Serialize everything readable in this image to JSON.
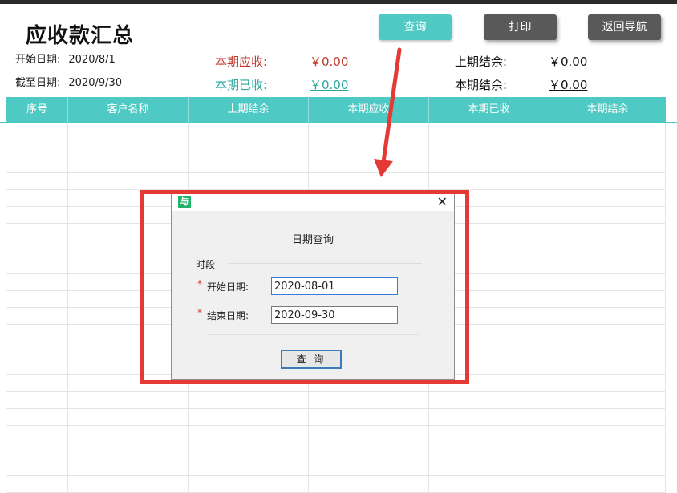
{
  "title": "应收款汇总",
  "meta": {
    "start_label": "开始日期:",
    "start_value": "2020/8/1",
    "end_label": "截至日期:",
    "end_value": "2020/9/30"
  },
  "buttons": {
    "query": "查询",
    "print": "打印",
    "nav": "返回导航"
  },
  "summary": {
    "receivable_label": "本期应收:",
    "receivable_value": "￥0.00",
    "received_label": "本期已收:",
    "received_value": "￥0.00",
    "prev_balance_label": "上期结余:",
    "prev_balance_value": "￥0.00",
    "curr_balance_label": "本期结余:",
    "curr_balance_value": "￥0.00"
  },
  "table": {
    "columns": [
      "序号",
      "客户名称",
      "上期结余",
      "本期应收",
      "本期已收",
      "本期结余"
    ]
  },
  "dialog": {
    "icon_glyph": "与",
    "close_glyph": "✕",
    "title": "日期查询",
    "group_label": "时段",
    "star": "*",
    "start_label": "开始日期:",
    "start_value": "2020-08-01",
    "end_label": "结束日期:",
    "end_value": "2020-09-30",
    "query_button": "查 询"
  },
  "colors": {
    "accent": "#4fc9c3",
    "dark_button": "#595959",
    "highlight": "#e53935",
    "receivable": "#c0392b",
    "received": "#2aa79f"
  }
}
